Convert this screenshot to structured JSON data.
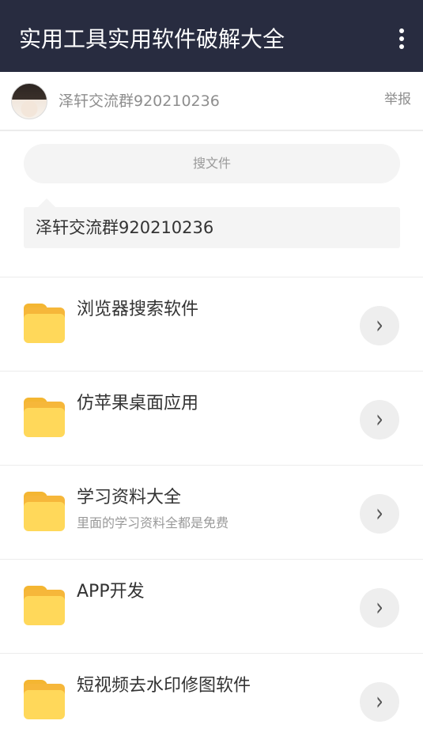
{
  "header": {
    "title": "实用工具实用软件破解大全",
    "menu_icon": "more-vertical-icon"
  },
  "owner": {
    "name": "泽轩交流群920210236",
    "report_label": "举报"
  },
  "search": {
    "placeholder": "搜文件"
  },
  "notice": {
    "text": "泽轩交流群920210236"
  },
  "folders": [
    {
      "label": "浏览器搜索软件",
      "desc": "",
      "icon": "folder-icon"
    },
    {
      "label": "仿苹果桌面应用",
      "desc": "",
      "icon": "folder-icon"
    },
    {
      "label": "学习资料大全",
      "desc": "里面的学习资料全都是免费",
      "icon": "folder-icon"
    },
    {
      "label": "APP开发",
      "desc": "",
      "icon": "folder-icon"
    },
    {
      "label": "短视频去水印修图软件",
      "desc": "",
      "icon": "folder-icon"
    }
  ]
}
